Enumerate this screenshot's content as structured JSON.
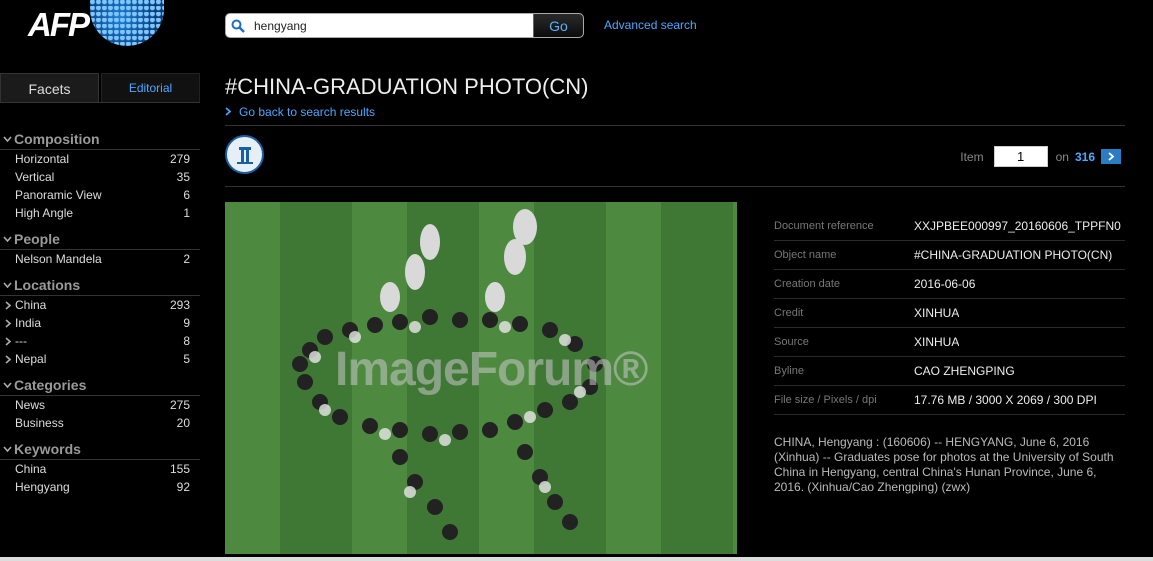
{
  "logo": {
    "text": "AFP"
  },
  "search": {
    "value": "hengyang",
    "button": "Go",
    "advanced": "Advanced search"
  },
  "tabs": {
    "facets": "Facets",
    "editorial": "Editorial"
  },
  "facets": [
    {
      "name": "Composition",
      "items": [
        {
          "label": "Horizontal",
          "count": "279"
        },
        {
          "label": "Vertical",
          "count": "35"
        },
        {
          "label": "Panoramic View",
          "count": "6"
        },
        {
          "label": "High Angle",
          "count": "1"
        }
      ]
    },
    {
      "name": "People",
      "items": [
        {
          "label": "Nelson Mandela",
          "count": "2"
        }
      ]
    },
    {
      "name": "Locations",
      "items": [
        {
          "label": "China",
          "count": "293"
        },
        {
          "label": "India",
          "count": "9"
        },
        {
          "label": "---",
          "count": "8"
        },
        {
          "label": "Nepal",
          "count": "5"
        }
      ]
    },
    {
      "name": "Categories",
      "items": [
        {
          "label": "News",
          "count": "275"
        },
        {
          "label": "Business",
          "count": "20"
        }
      ]
    },
    {
      "name": "Keywords",
      "items": [
        {
          "label": "China",
          "count": "155"
        },
        {
          "label": "Hengyang",
          "count": "92"
        }
      ]
    }
  ],
  "page": {
    "title": "#CHINA-GRADUATION PHOTO(CN)",
    "back": "Go back to search results"
  },
  "pager": {
    "label": "Item",
    "current": "1",
    "on": "on",
    "total": "316"
  },
  "photo": {
    "watermark": "ImageForum®"
  },
  "meta": {
    "doc_ref_k": "Document reference",
    "doc_ref_v": "XXJPBEE000997_20160606_TPPFN0",
    "obj_k": "Object name",
    "obj_v": "#CHINA-GRADUATION PHOTO(CN)",
    "date_k": "Creation date",
    "date_v": "2016-06-06",
    "credit_k": "Credit",
    "credit_v": "XINHUA",
    "source_k": "Source",
    "source_v": "XINHUA",
    "byline_k": "Byline",
    "byline_v": "CAO ZHENGPING",
    "size_k": "File size / Pixels / dpi",
    "size_v": "17.76 MB / 3000 X 2069 / 300 DPI"
  },
  "caption": "CHINA, Hengyang : (160606) -- HENGYANG, June 6, 2016 (Xinhua) -- Graduates pose for photos at the University of South China in Hengyang, central China's Hunan Province, June 6, 2016. (Xinhua/Cao Zhengping) (zwx)"
}
